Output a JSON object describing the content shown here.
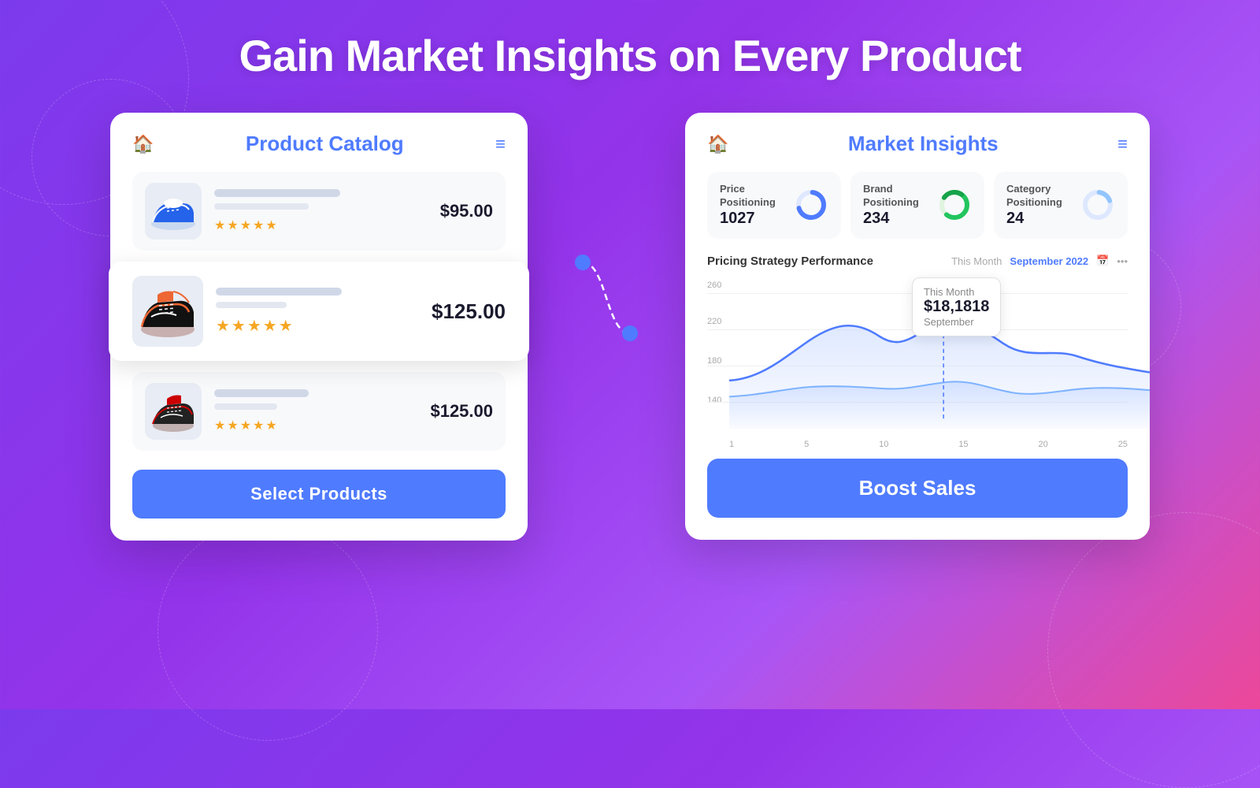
{
  "headline": "Gain Market Insights on Every Product",
  "left_panel": {
    "title": "Product Catalog",
    "products": [
      {
        "price": "$95.00",
        "stars": "★★★★★",
        "highlighted": false,
        "color": "blue"
      },
      {
        "price": "$125.00",
        "stars": "★★★★★",
        "highlighted": true,
        "color": "red"
      },
      {
        "price": "$125.00",
        "stars": "★★★★★",
        "highlighted": false,
        "color": "redblack"
      }
    ],
    "select_btn_label": "Select Products"
  },
  "right_panel": {
    "title": "Market Insights",
    "metrics": [
      {
        "label": "Price Positioning",
        "value": "1027",
        "chart_type": "donut_blue"
      },
      {
        "label": "Brand Positioning",
        "value": "234",
        "chart_type": "donut_green"
      },
      {
        "label": "Category Positioning",
        "value": "24",
        "chart_type": "donut_blue_light"
      }
    ],
    "chart": {
      "title": "Pricing Strategy Performance",
      "period_inactive": "This Month",
      "period_active": "September 2022",
      "y_labels": [
        "260",
        "220",
        "180",
        "140"
      ],
      "x_labels": [
        "1",
        "5",
        "10",
        "15",
        "20",
        "25"
      ],
      "tooltip": {
        "label": "This Month",
        "value": "$18,1818",
        "month": "September"
      }
    },
    "boost_btn_label": "Boost Sales"
  }
}
